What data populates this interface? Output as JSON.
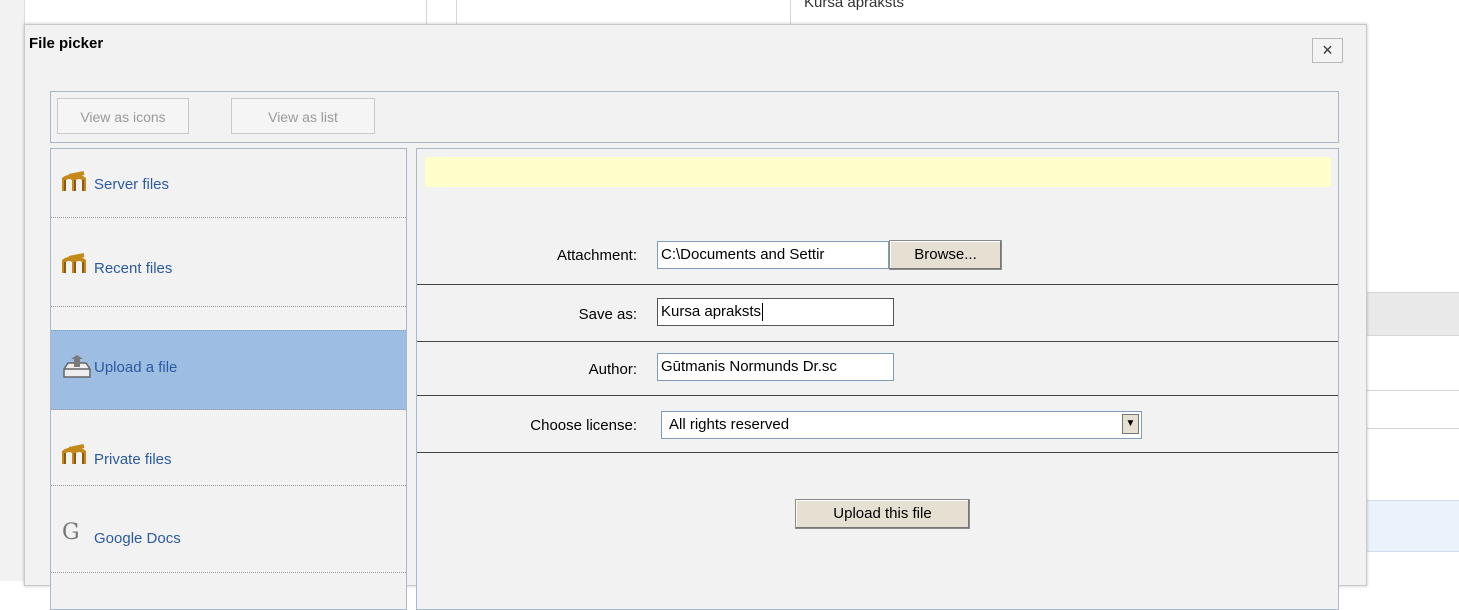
{
  "background": {
    "top_text": "Kursa apraksts"
  },
  "dialog": {
    "title": "File picker",
    "close_glyph": "×"
  },
  "toolbar": {
    "view_icons": "View as icons",
    "view_list": "View as list"
  },
  "sidebar": {
    "items": [
      {
        "label": "Server files",
        "icon": "moodle-icon"
      },
      {
        "label": "Recent files",
        "icon": "moodle-icon"
      },
      {
        "label": "Upload a file",
        "icon": "upload-icon",
        "active": true
      },
      {
        "label": "Private files",
        "icon": "moodle-icon"
      },
      {
        "label": "Google Docs",
        "icon": "google-icon"
      }
    ]
  },
  "form": {
    "attachment_label": "Attachment:",
    "attachment_value": "C:\\Documents and Settir",
    "browse_label": "Browse...",
    "saveas_label": "Save as:",
    "saveas_value": "Kursa apraksts",
    "author_label": "Author:",
    "author_value": "Gūtmanis Normunds Dr.sc",
    "license_label": "Choose license:",
    "license_value": "All rights reserved",
    "upload_label": "Upload this file"
  },
  "colors": {
    "accent_blue": "#2c5aa0",
    "active_item": "#9ebde2",
    "notice_bg": "#ffffcc"
  }
}
